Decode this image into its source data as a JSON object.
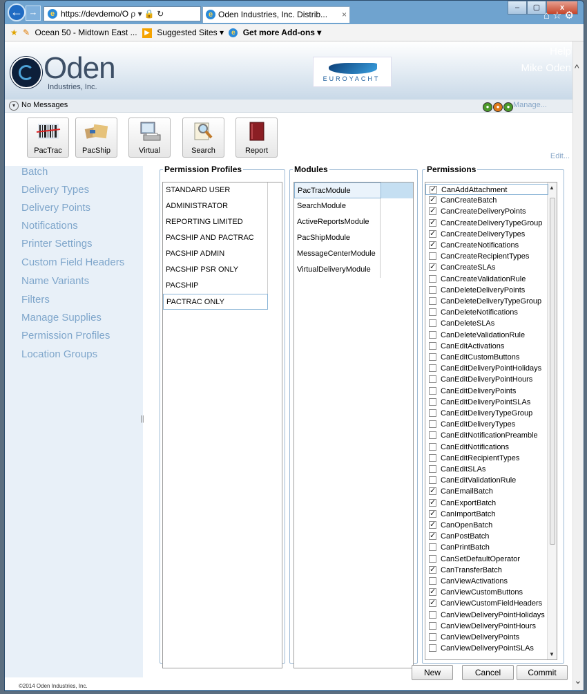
{
  "browser": {
    "address": "https://devdemo/O",
    "address_icons": "ρ ▾ 🔒 ↻",
    "tab_title": "Oden Industries, Inc. Distrib...",
    "tab_close": "×",
    "window_controls": {
      "minimize": "–",
      "maximize": "▢",
      "close": "x"
    },
    "top_icons": "⌂☆⚙",
    "favorites": {
      "item1": "Ocean 50 - Midtown East ...",
      "item2": "Suggested Sites ▾",
      "item3": "Get more Add-ons ▾"
    }
  },
  "header": {
    "logo_text": "Oden",
    "logo_sub": "Industries, Inc.",
    "brand_text": "EUROYACHT",
    "help": "Help",
    "user": "Mike Oden"
  },
  "messages": {
    "text": "No Messages",
    "manage": "Manage..."
  },
  "toolbar": {
    "pactrac": "PacTrac",
    "pacship": "PacShip",
    "virtual": "Virtual",
    "search": "Search",
    "report": "Report",
    "edit": "Edit..."
  },
  "sidebar": [
    "Batch",
    "Delivery Types",
    "Delivery Points",
    "Notifications",
    "Printer Settings",
    "Custom Field Headers",
    "Name Variants",
    "Filters",
    "Manage Supplies",
    "Permission Profiles",
    "Location Groups"
  ],
  "profiles": {
    "title": "Permission Profiles",
    "items": [
      "STANDARD USER",
      "ADMINISTRATOR",
      "REPORTING LIMITED",
      "PACSHIP AND PACTRAC",
      "PACSHIP ADMIN",
      "PACSHIP PSR ONLY",
      "PACSHIP",
      "PACTRAC ONLY"
    ],
    "selected": "PACTRAC ONLY"
  },
  "modules": {
    "title": "Modules",
    "items": [
      "PacTracModule",
      "SearchModule",
      "ActiveReportsModule",
      "PacShipModule",
      "MessageCenterModule",
      "VirtualDeliveryModule"
    ],
    "selected": "PacTracModule"
  },
  "permissions": {
    "title": "Permissions",
    "items": [
      {
        "label": "CanAddAttachment",
        "checked": true
      },
      {
        "label": "CanCreateBatch",
        "checked": true
      },
      {
        "label": "CanCreateDeliveryPoints",
        "checked": true
      },
      {
        "label": "CanCreateDeliveryTypeGroup",
        "checked": true
      },
      {
        "label": "CanCreateDeliveryTypes",
        "checked": true
      },
      {
        "label": "CanCreateNotifications",
        "checked": true
      },
      {
        "label": "CanCreateRecipientTypes",
        "checked": false
      },
      {
        "label": "CanCreateSLAs",
        "checked": true
      },
      {
        "label": "CanCreateValidationRule",
        "checked": false
      },
      {
        "label": "CanDeleteDeliveryPoints",
        "checked": false
      },
      {
        "label": "CanDeleteDeliveryTypeGroup",
        "checked": false
      },
      {
        "label": "CanDeleteNotifications",
        "checked": false
      },
      {
        "label": "CanDeleteSLAs",
        "checked": false
      },
      {
        "label": "CanDeleteValidationRule",
        "checked": false
      },
      {
        "label": "CanEditActivations",
        "checked": false
      },
      {
        "label": "CanEditCustomButtons",
        "checked": false
      },
      {
        "label": "CanEditDeliveryPointHolidays",
        "checked": false
      },
      {
        "label": "CanEditDeliveryPointHours",
        "checked": false
      },
      {
        "label": "CanEditDeliveryPoints",
        "checked": false
      },
      {
        "label": "CanEditDeliveryPointSLAs",
        "checked": false
      },
      {
        "label": "CanEditDeliveryTypeGroup",
        "checked": false
      },
      {
        "label": "CanEditDeliveryTypes",
        "checked": false
      },
      {
        "label": "CanEditNotificationPreamble",
        "checked": false
      },
      {
        "label": "CanEditNotifications",
        "checked": false
      },
      {
        "label": "CanEditRecipientTypes",
        "checked": false
      },
      {
        "label": "CanEditSLAs",
        "checked": false
      },
      {
        "label": "CanEditValidationRule",
        "checked": false
      },
      {
        "label": "CanEmailBatch",
        "checked": true
      },
      {
        "label": "CanExportBatch",
        "checked": true
      },
      {
        "label": "CanImportBatch",
        "checked": true
      },
      {
        "label": "CanOpenBatch",
        "checked": true
      },
      {
        "label": "CanPostBatch",
        "checked": true
      },
      {
        "label": "CanPrintBatch",
        "checked": false
      },
      {
        "label": "CanSetDefaultOperator",
        "checked": false
      },
      {
        "label": "CanTransferBatch",
        "checked": true
      },
      {
        "label": "CanViewActivations",
        "checked": false
      },
      {
        "label": "CanViewCustomButtons",
        "checked": true
      },
      {
        "label": "CanViewCustomFieldHeaders",
        "checked": true
      },
      {
        "label": "CanViewDeliveryPointHolidays",
        "checked": false
      },
      {
        "label": "CanViewDeliveryPointHours",
        "checked": false
      },
      {
        "label": "CanViewDeliveryPoints",
        "checked": false
      },
      {
        "label": "CanViewDeliveryPointSLAs",
        "checked": false
      }
    ],
    "selected": "CanAddAttachment",
    "check_mark": "✓"
  },
  "buttons": {
    "new": "New",
    "cancel": "Cancel",
    "commit": "Commit"
  },
  "footer": "©2014 Oden Industries, Inc.",
  "colors": {
    "accent": "#7fa6cb",
    "frame": "#6fa3cf",
    "sidebar_bg": "#e8f0f8"
  }
}
